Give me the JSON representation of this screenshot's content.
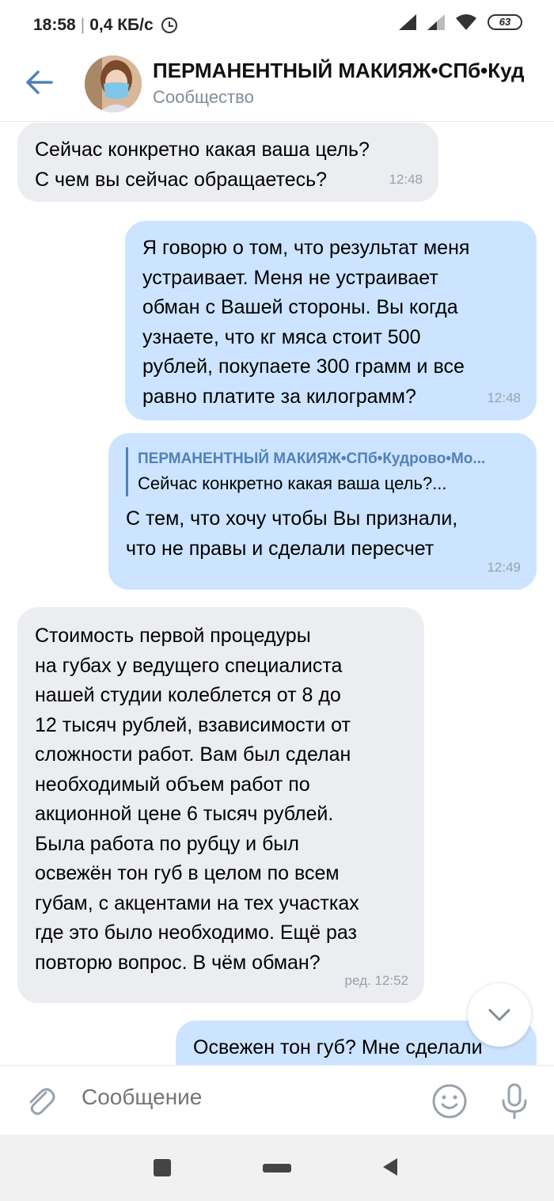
{
  "status_bar": {
    "time": "18:58",
    "speed": "0,4 КБ/с",
    "battery": "63"
  },
  "header": {
    "title": "ПЕРМАНЕНТНЫЙ МАКИЯЖ•СПб•Куд",
    "subtitle": "Сообщество"
  },
  "messages": [
    {
      "direction": "in",
      "text": "Сейчас конкретно какая ваша цель?\nС чем вы сейчас обращаетесь?",
      "time": "12:48"
    },
    {
      "direction": "out",
      "text": "Я говорю о том, что результат меня\nустраивает. Меня не устраивает\nобман с Вашей стороны. Вы когда\nузнаете, что кг мяса стоит 500\nрублей, покупаете 300 грамм и все\nравно платите за килограмм?",
      "time": "12:48"
    },
    {
      "direction": "out",
      "reply_author": "ПЕРМАНЕНТНЫЙ МАКИЯЖ•СПб•Кудрово•Мо...",
      "reply_text": "Сейчас конкретно какая ваша цель?...",
      "text": "С тем, что хочу чтобы Вы признали,\nчто не правы и сделали пересчет",
      "time": "12:49"
    },
    {
      "direction": "in",
      "text": "Стоимость первой процедуры\nна губах у ведущего специалиста\nнашей студии колеблется от 8 до\n12 тысяч рублей, взависимости от\nсложности работ. Вам был сделан\nнеобходимый объем работ по\nакционной цене 6 тысяч рублей.\nБыла работа по рубцу и был\nосвежён тон губ в целом по всем\nгубам, с акцентами на тех участках\nгде это было необходимо. Ещё раз\nповторю вопрос. В чём обман?",
      "time": "ред. 12:52"
    },
    {
      "direction": "out",
      "text": "Освежен тон губ? Мне сделали"
    }
  ],
  "composer": {
    "placeholder": "Сообщение"
  },
  "icons": [
    "back-arrow-icon",
    "alarm-icon",
    "signal-icon",
    "wifi-icon",
    "battery-icon",
    "chevron-down-icon",
    "paperclip-icon",
    "emoji-icon",
    "microphone-icon"
  ],
  "colors": {
    "accent": "#5181b8",
    "incoming_bubble": "#ebedf0",
    "outgoing_bubble": "#cce4ff",
    "secondary_text": "#818c99"
  }
}
